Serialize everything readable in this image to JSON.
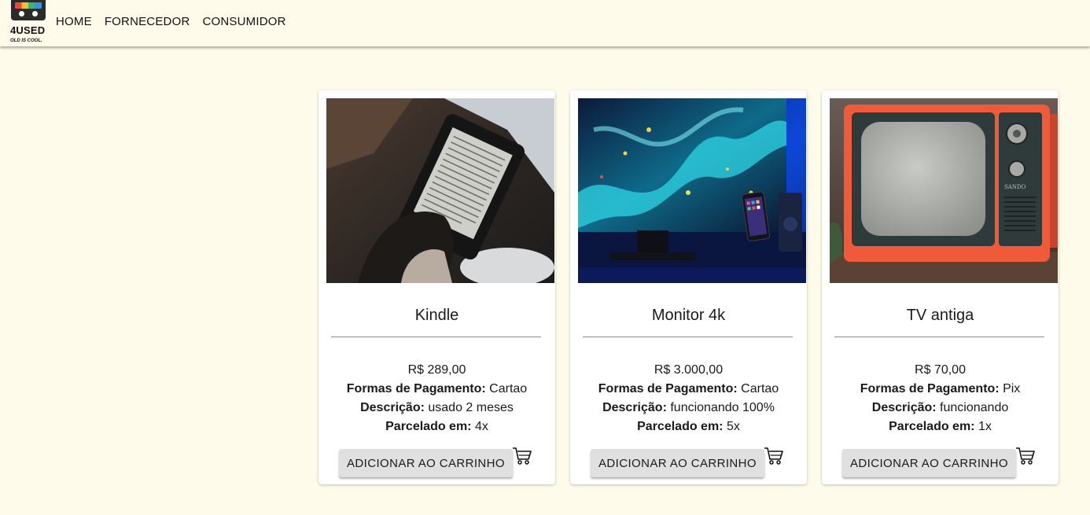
{
  "header": {
    "logo_text": "4USED",
    "logo_tagline": "OLD IS COOL.",
    "nav": [
      "HOME",
      "FORNECEDOR",
      "CONSUMIDOR"
    ]
  },
  "labels": {
    "payment": "Formas de Pagamento:",
    "description": "Descrição:",
    "installments": "Parcelado em:",
    "add_to_cart": "ADICIONAR AO CARRINHO"
  },
  "products": [
    {
      "title": "Kindle",
      "price": "R$ 289,00",
      "payment": "Cartao",
      "description": "usado 2 meses",
      "installments": "4x",
      "image_icon": "ereader-photo"
    },
    {
      "title": "Monitor 4k",
      "price": "R$ 3.000,00",
      "payment": "Cartao",
      "description": "funcionando 100%",
      "installments": "5x",
      "image_icon": "monitor-photo"
    },
    {
      "title": "TV antiga",
      "price": "R$ 70,00",
      "payment": "Pix",
      "description": "funcionando",
      "installments": "1x",
      "image_icon": "vintage-tv-photo"
    }
  ],
  "colors": {
    "background": "#fffbea",
    "card": "#ffffff",
    "button": "#e0e0e0",
    "tv_orange": "#ee5a3a"
  }
}
